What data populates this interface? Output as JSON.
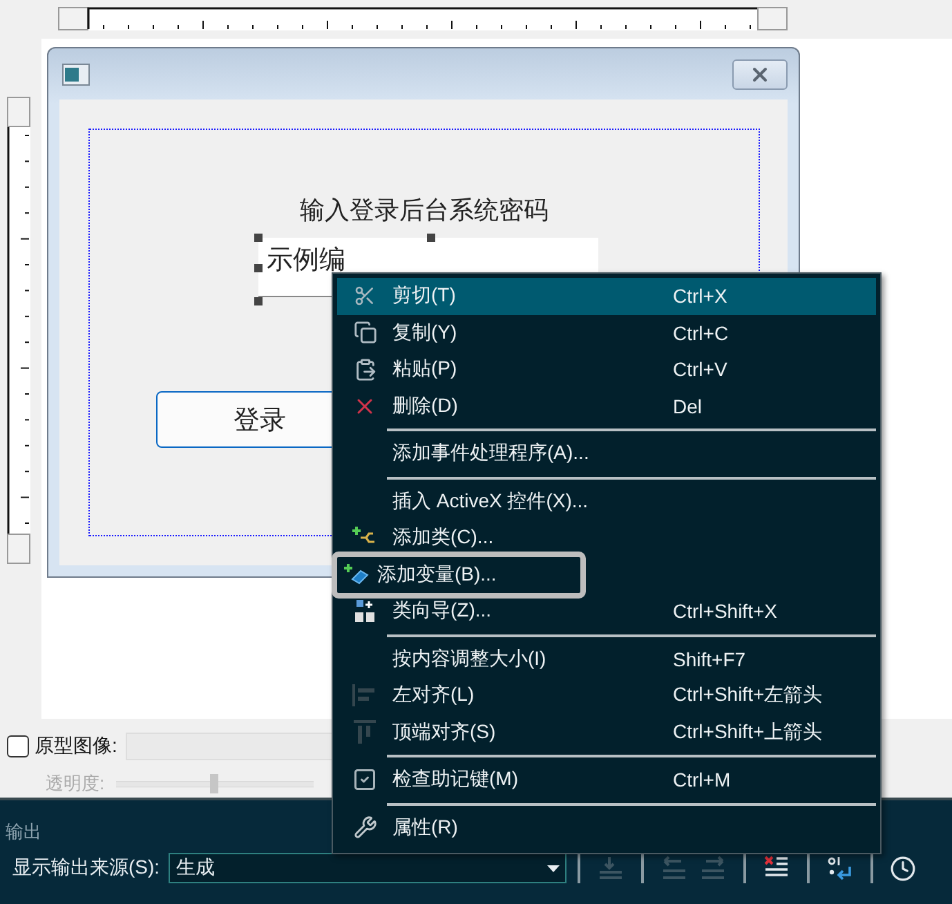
{
  "dialog": {
    "prompt": "输入登录后台系统密码",
    "edit_box": {
      "value": "示例编"
    },
    "button": "登录"
  },
  "context_menu": [
    {
      "kind": "cut",
      "label": "剪切(T)",
      "shortcut": "Ctrl+X",
      "selected": true,
      "outlined": false
    },
    {
      "kind": "copy",
      "label": "复制(Y)",
      "shortcut": "Ctrl+C",
      "selected": false,
      "outlined": false
    },
    {
      "kind": "paste",
      "label": "粘贴(P)",
      "shortcut": "Ctrl+V",
      "selected": false,
      "outlined": false
    },
    {
      "kind": "delete",
      "label": "删除(D)",
      "shortcut": "Del",
      "selected": false,
      "outlined": false
    },
    {
      "kind": "separator"
    },
    {
      "kind": "plain",
      "label": "添加事件处理程序(A)...",
      "selected": false,
      "outlined": false
    },
    {
      "kind": "separator"
    },
    {
      "kind": "plain",
      "label": "插入 ActiveX 控件(X)...",
      "selected": false,
      "outlined": false
    },
    {
      "kind": "addclass",
      "label": "添加类(C)...",
      "selected": false,
      "outlined": false
    },
    {
      "kind": "addvariable",
      "label": "添加变量(B)...",
      "selected": false,
      "outlined": true
    },
    {
      "kind": "wizard",
      "label": "类向导(Z)...",
      "shortcut": "Ctrl+Shift+X",
      "selected": false,
      "outlined": false
    },
    {
      "kind": "separator"
    },
    {
      "kind": "plain",
      "label": "按内容调整大小(I)",
      "shortcut": "Shift+F7",
      "selected": false,
      "outlined": false
    },
    {
      "kind": "alignleft",
      "label": "左对齐(L)",
      "shortcut": "Ctrl+Shift+左箭头",
      "selected": false,
      "outlined": false
    },
    {
      "kind": "aligntop",
      "label": "顶端对齐(S)",
      "shortcut": "Ctrl+Shift+上箭头",
      "selected": false,
      "outlined": false
    },
    {
      "kind": "separator"
    },
    {
      "kind": "check",
      "label": "检查助记键(M)",
      "shortcut": "Ctrl+M",
      "selected": false,
      "outlined": false
    },
    {
      "kind": "separator"
    },
    {
      "kind": "wrench",
      "label": "属性(R)",
      "selected": false,
      "outlined": false
    }
  ],
  "prototype": {
    "label": "原型图像:",
    "checked": false,
    "opacity_label": "透明度:",
    "opacity": {
      "level": 0.5
    }
  },
  "output": {
    "title": "输出",
    "source_label": "显示输出来源(S):",
    "source_value": "生成",
    "tools": [
      {
        "kind": "goto",
        "disabled": true
      },
      {
        "kind": "prev",
        "disabled": true
      },
      {
        "kind": "next",
        "disabled": true
      },
      {
        "kind": "clear",
        "disabled": false
      },
      {
        "kind": "wrap",
        "disabled": false
      },
      {
        "kind": "clock",
        "disabled": false
      }
    ]
  }
}
